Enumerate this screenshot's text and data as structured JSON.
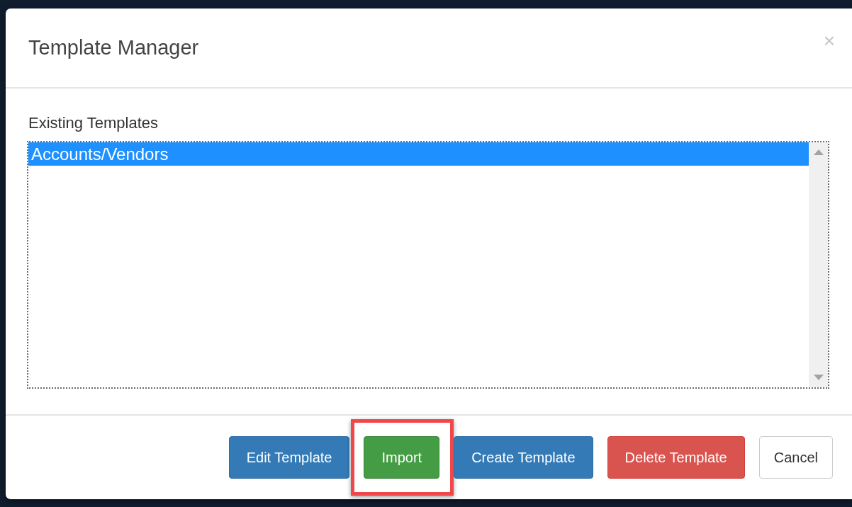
{
  "dialog": {
    "title": "Template Manager",
    "close": "×"
  },
  "templates": {
    "label": "Existing Templates",
    "items": [
      {
        "name": "Accounts/Vendors",
        "selected": true
      }
    ]
  },
  "buttons": [
    {
      "label": "Edit Template",
      "kind": "primary",
      "highlighted": false
    },
    {
      "label": "Import",
      "kind": "success",
      "highlighted": true
    },
    {
      "label": "Create Template",
      "kind": "primary",
      "highlighted": false
    },
    {
      "label": "Delete Template",
      "kind": "danger",
      "highlighted": false
    },
    {
      "label": "Cancel",
      "kind": "default",
      "highlighted": false
    }
  ]
}
